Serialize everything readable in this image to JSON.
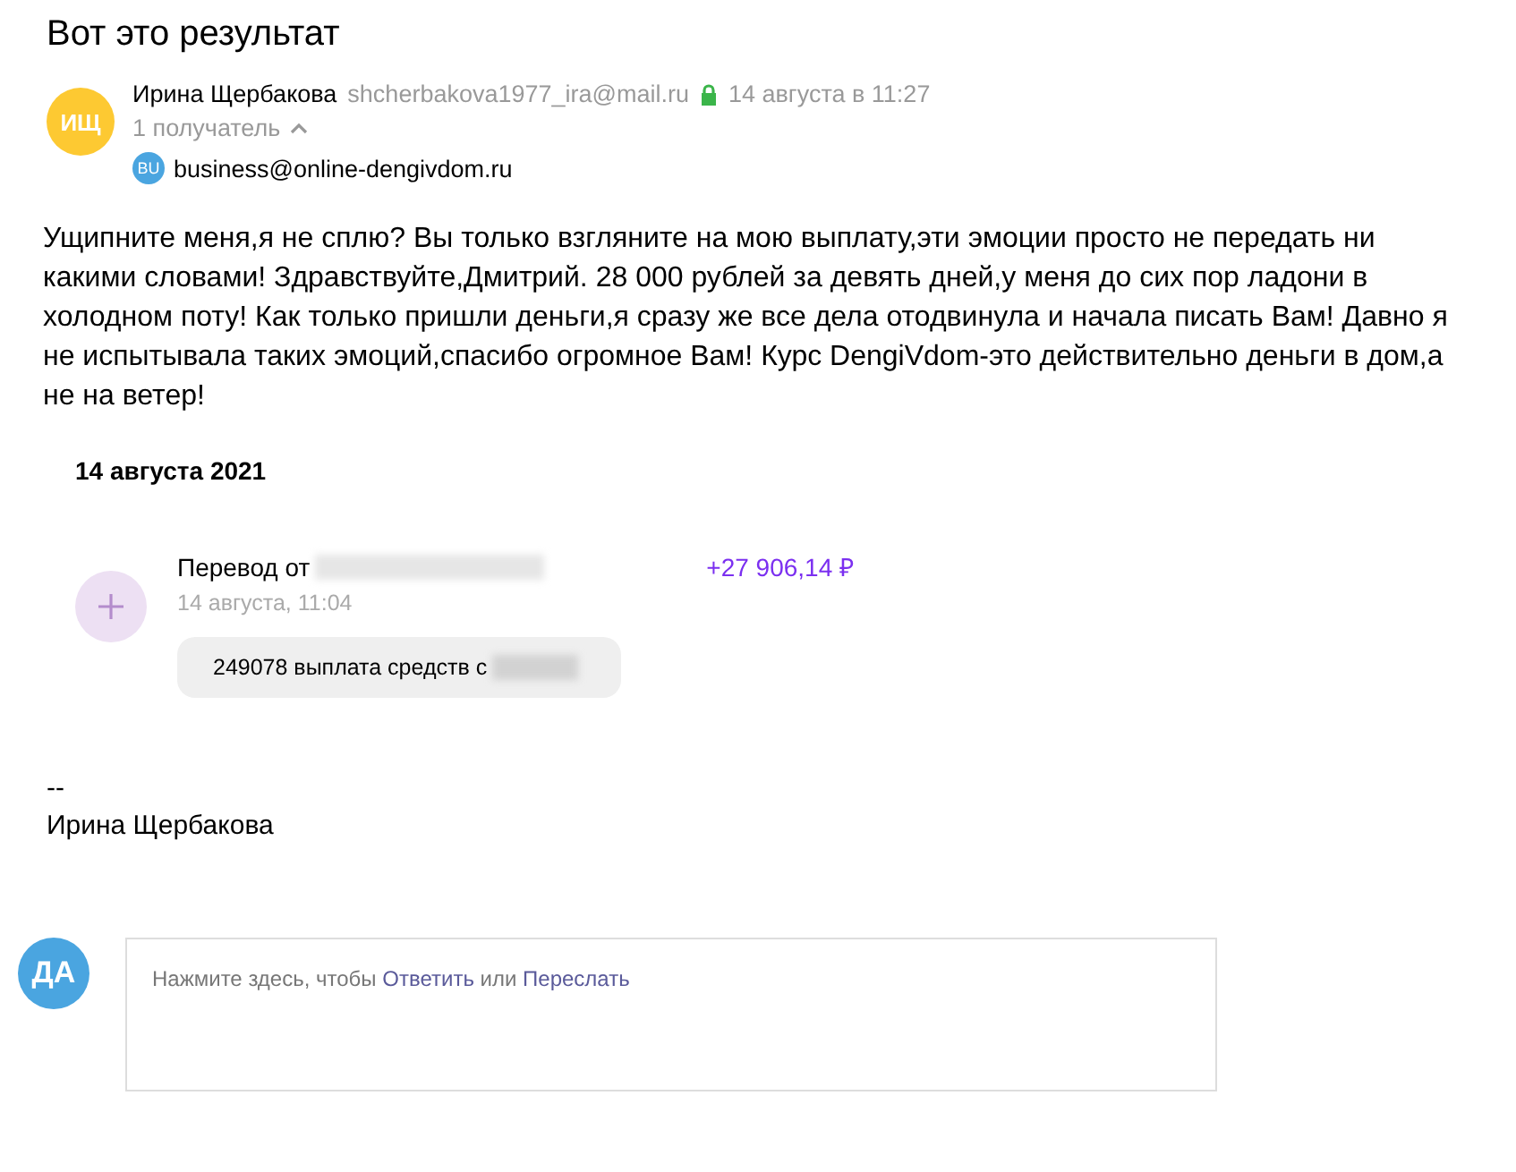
{
  "subject": "Вот это результат",
  "sender": {
    "initials": "ИЩ",
    "name": "Ирина Щербакова",
    "email": "shcherbakova1977_ira@mail.ru",
    "date": "14 августа в 11:27"
  },
  "recipients": {
    "label": "1 получатель",
    "expanded": true,
    "items": [
      {
        "initials": "BU",
        "email": "business@online-dengivdom.ru"
      }
    ]
  },
  "body": "Ущипните меня,я не сплю? Вы только взгляните на мою выплату,эти эмоции просто не передать ни какими словами! Здравствуйте,Дмитрий. 28 000 рублей за девять дней,у меня до сих пор ладони в холодном поту! Как только пришли деньги,я сразу же все дела отодвинула и начала писать Вам! Давно я не испытывала таких эмоций,спасибо огромное Вам! Курс DengiVdom-это действительно деньги в дом,а не на ветер!",
  "screenshot": {
    "date_heading": "14 августа 2021",
    "transfer_title": "Перевод от",
    "amount": "+27 906,14 ₽",
    "time": "14 августа, 11:04",
    "message": "249078 выплата средств с"
  },
  "signature": {
    "dashes": "--",
    "name": "Ирина Щербакова"
  },
  "reply": {
    "initials": "ДА",
    "hint_prefix": "Нажмите здесь, чтобы",
    "reply_link": "Ответить",
    "or": "или",
    "forward_link": "Переслать"
  }
}
